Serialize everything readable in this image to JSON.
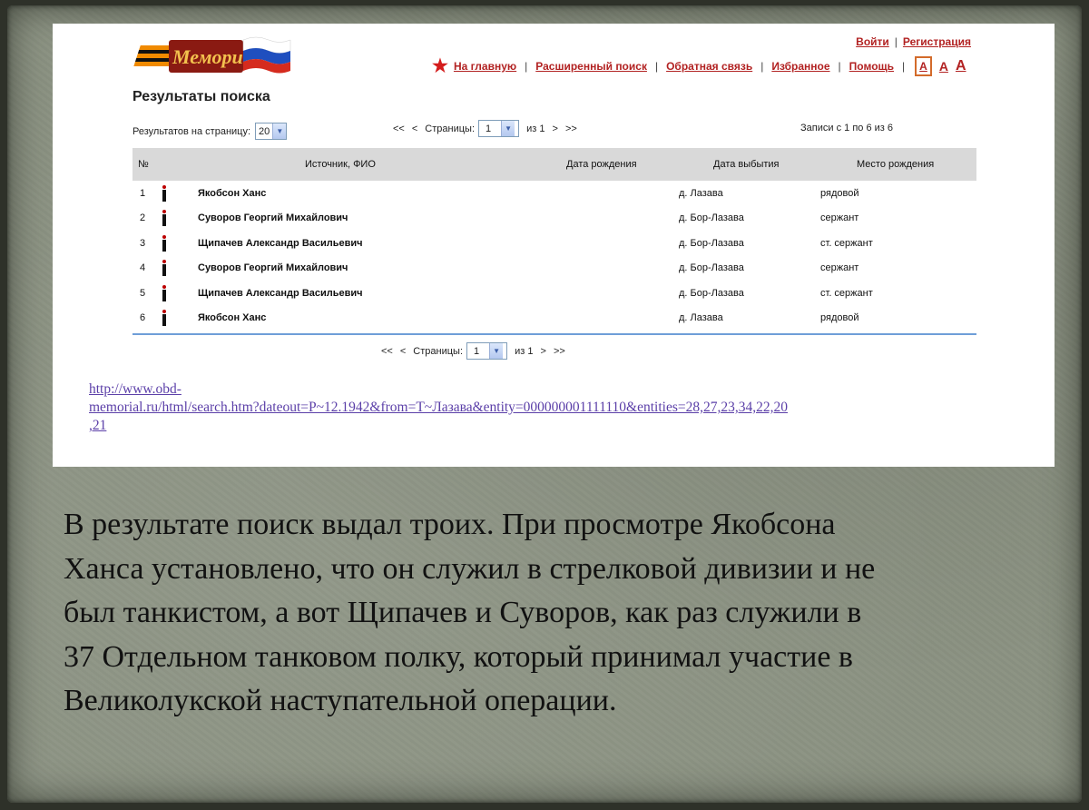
{
  "header": {
    "logo_text": "Мемориал",
    "top_links": [
      "Войти",
      "Регистрация"
    ],
    "nav": [
      "На главную",
      "Расширенный поиск",
      "Обратная связь",
      "Избранное",
      "Помощь"
    ],
    "font_sizes": [
      "A",
      "A",
      "A"
    ]
  },
  "results": {
    "title": "Результаты поиска",
    "per_page_label": "Результатов на страницу:",
    "per_page_value": "20",
    "pager": {
      "first": "<<",
      "prev": "<",
      "pages_label": "Страницы:",
      "page_value": "1",
      "of_label": "из 1",
      "next": ">",
      "last": ">>"
    },
    "records_label": "Записи с 1 по 6 из 6"
  },
  "table": {
    "headers": [
      "№",
      "Источник, ФИО",
      "Дата рождения",
      "Дата выбытия",
      "Место рождения"
    ],
    "rows": [
      {
        "num": "1",
        "name": "Якобсон Ханс",
        "death": "д. Лазава",
        "place": "рядовой"
      },
      {
        "num": "2",
        "name": "Суворов Георгий Михайлович",
        "death": "д. Бор-Лазава",
        "place": "сержант"
      },
      {
        "num": "3",
        "name": "Щипачев Александр Васильевич",
        "death": "д. Бор-Лазава",
        "place": "ст. сержант"
      },
      {
        "num": "4",
        "name": "Суворов Георгий Михайлович",
        "death": "д. Бор-Лазава",
        "place": "сержант"
      },
      {
        "num": "5",
        "name": "Щипачев Александр Васильевич",
        "death": "д. Бор-Лазава",
        "place": "ст. сержант"
      },
      {
        "num": "6",
        "name": "Якобсон Ханс",
        "death": "д. Лазава",
        "place": "рядовой"
      }
    ]
  },
  "source_url": {
    "line1": "http://www.obd-",
    "line2": "memorial.ru/html/search.htm?dateout=P~12.1942&from=T~Лазава&entity=000000001111110&entities=28,27,23,34,22,20",
    "line3": ",21"
  },
  "caption": {
    "lines": [
      "В результате поиск выдал троих. При просмотре Якобсона",
      "Ханса установлено, что он служил в стрелковой дивизии и не",
      "был танкистом, а вот Щипачев и Суворов, как раз служили в",
      "37 Отдельном танковом полку, который принимал участие в",
      "Великолукской наступательной операции."
    ]
  },
  "colors": {
    "link_red": "#b22222",
    "link_purple": "#5b3fa8",
    "table_header": "#d9d9d9"
  }
}
